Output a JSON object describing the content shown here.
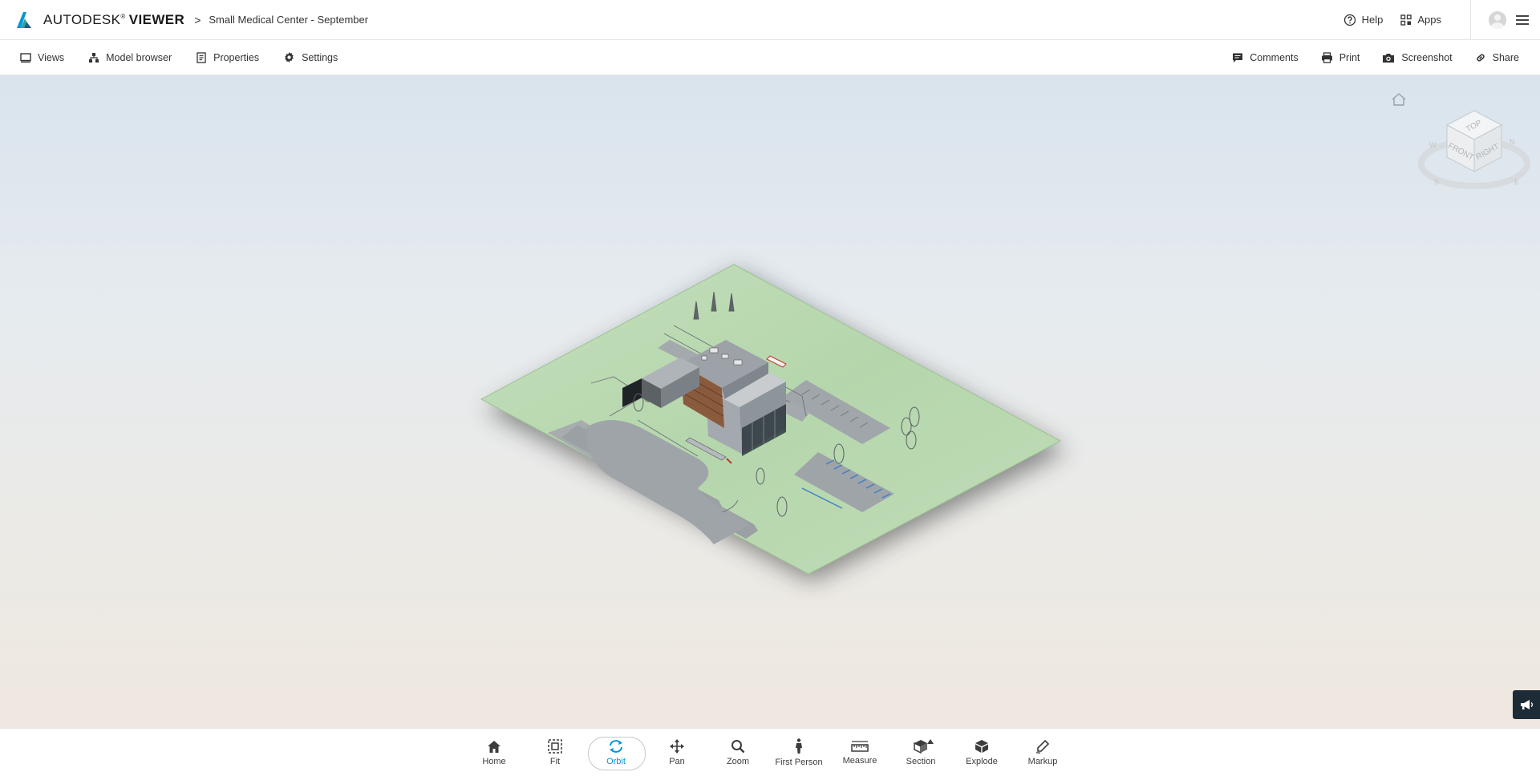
{
  "header": {
    "brand_first": "AUTODESK",
    "brand_sup": "®",
    "brand_second": "VIEWER",
    "breadcrumb_separator": ">",
    "document_title": "Small Medical Center - September",
    "help_label": "Help",
    "apps_label": "Apps"
  },
  "toolbar": {
    "left": [
      {
        "label": "Views",
        "icon": "views-icon"
      },
      {
        "label": "Model browser",
        "icon": "model-browser-icon"
      },
      {
        "label": "Properties",
        "icon": "properties-icon"
      },
      {
        "label": "Settings",
        "icon": "gear-icon"
      }
    ],
    "right": [
      {
        "label": "Comments",
        "icon": "comment-icon"
      },
      {
        "label": "Print",
        "icon": "printer-icon"
      },
      {
        "label": "Screenshot",
        "icon": "camera-icon"
      },
      {
        "label": "Share",
        "icon": "link-icon"
      }
    ]
  },
  "viewcube": {
    "top": "TOP",
    "front": "FRONT",
    "right": "RIGHT",
    "compass_n": "N",
    "compass_s": "S",
    "compass_e": "E",
    "compass_w": "W"
  },
  "bottom_toolbar": {
    "active": "Orbit",
    "items": [
      {
        "label": "Home",
        "icon": "home-icon"
      },
      {
        "label": "Fit",
        "icon": "fit-icon"
      },
      {
        "label": "Orbit",
        "icon": "orbit-icon"
      },
      {
        "label": "Pan",
        "icon": "pan-icon"
      },
      {
        "label": "Zoom",
        "icon": "zoom-icon"
      },
      {
        "label": "First Person",
        "icon": "first-person-icon"
      },
      {
        "label": "Measure",
        "icon": "measure-icon"
      },
      {
        "label": "Section",
        "icon": "section-icon"
      },
      {
        "label": "Explode",
        "icon": "explode-icon"
      },
      {
        "label": "Markup",
        "icon": "markup-icon"
      }
    ]
  },
  "colors": {
    "accent": "#0696d7",
    "site_grass": "#b8d8b0",
    "road": "#9aa0a4",
    "feedback_tab": "#1d2b36"
  }
}
